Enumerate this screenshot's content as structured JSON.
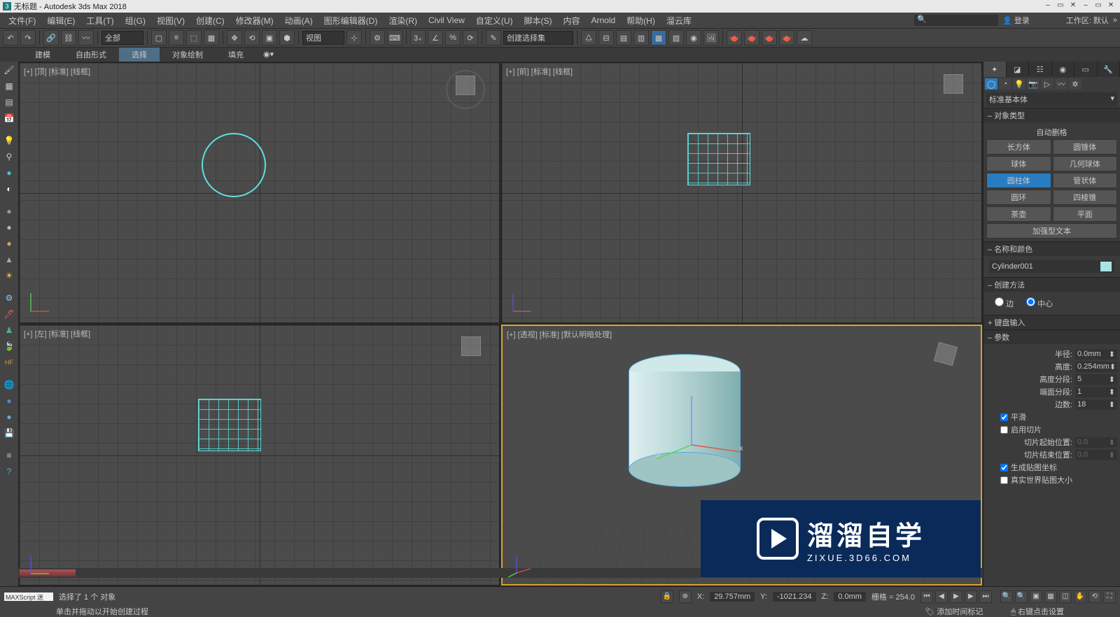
{
  "titlebar": {
    "text": "无标题 - Autodesk 3ds Max 2018"
  },
  "menu": {
    "items": [
      "文件(F)",
      "编辑(E)",
      "工具(T)",
      "组(G)",
      "视图(V)",
      "创建(C)",
      "修改器(M)",
      "动画(A)",
      "图形编辑器(D)",
      "渲染(R)",
      "Civil View",
      "自定义(U)",
      "脚本(S)",
      "内容",
      "Arnold",
      "帮助(H)",
      "溜云库"
    ],
    "login": "登录",
    "workspace_label": "工作区: 默认"
  },
  "maintoolbar": {
    "set_combo": "全部",
    "view_combo": "视图",
    "selset_combo": "创建选择集"
  },
  "ribbon": {
    "tabs": [
      "建模",
      "自由形式",
      "选择",
      "对象绘制",
      "填充"
    ],
    "active": 2
  },
  "viewports": {
    "tl": "[+] [顶] [标准] [线框]",
    "tr": "[+] [前] [标准] [线框]",
    "bl": "[+] [左] [标准] [线框]",
    "br": "[+] [透视] [标准] [默认明暗处理]"
  },
  "cmd": {
    "dropdown": "标准基本体",
    "roll_objtype": "对象类型",
    "autogrid": "自动删格",
    "prims": [
      "长方体",
      "圆锥体",
      "球体",
      "几何球体",
      "圆柱体",
      "管状体",
      "圆环",
      "四棱锥",
      "茶壶",
      "平面",
      "加强型文本"
    ],
    "prim_active": 4,
    "roll_name": "名称和颜色",
    "objname": "Cylinder001",
    "roll_method": "创建方法",
    "radio_edge": "边",
    "radio_center": "中心",
    "roll_kbd": "键盘输入",
    "roll_params": "参数",
    "p_radius": "半径:",
    "v_radius": "0.0mm",
    "p_height": "高度:",
    "v_height": "0.254mm",
    "p_hseg": "高度分段:",
    "v_hseg": "5",
    "p_cseg": "端面分段:",
    "v_cseg": "1",
    "p_sides": "边数:",
    "v_sides": "18",
    "chk_smooth": "平滑",
    "chk_slice": "启用切片",
    "p_sfrom": "切片起始位置:",
    "v_sfrom": "0.0",
    "p_sto": "切片结束位置:",
    "v_sto": "0.0",
    "chk_genmap": "生成贴图坐标",
    "chk_realworld": "真实世界贴图大小"
  },
  "status": {
    "sel": "选择了 1 个 对象",
    "prompt": "单击并拖动以开始创建过程",
    "maxscript": "MAXScript 迷",
    "x_lbl": "X:",
    "x": "29.757mm",
    "y_lbl": "Y:",
    "y": "-1021.234",
    "z_lbl": "Z:",
    "z": "0.0mm",
    "grid_lbl": "栅格 = 254.0",
    "addtime": "添加时间标记",
    "tooltip": "右键点击设置"
  },
  "watermark": {
    "big": "溜溜自学",
    "url": "ZIXUE.3D66.COM"
  }
}
